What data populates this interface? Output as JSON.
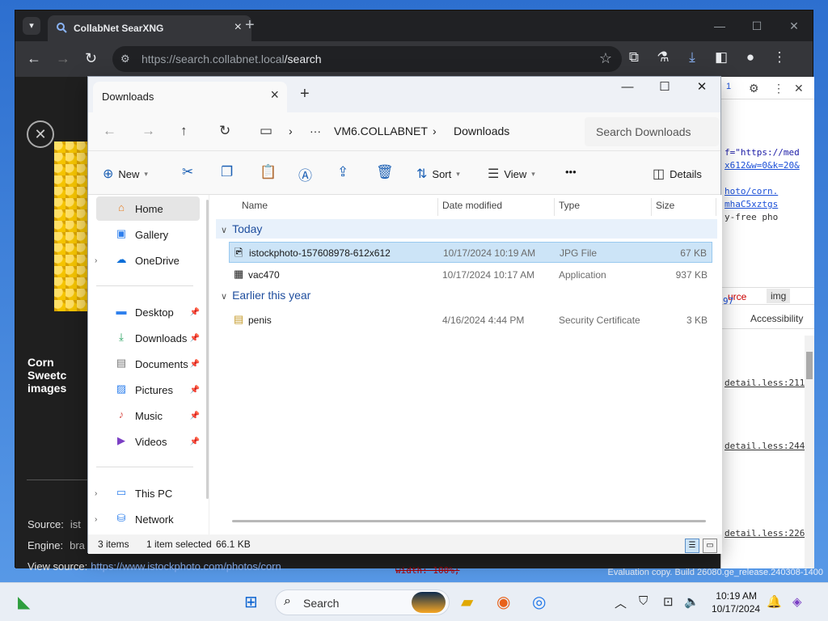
{
  "browser": {
    "tab_title": "CollabNet SearXNG",
    "url_host": "https://search.collabnet.local",
    "url_path": "/search",
    "page": {
      "image_title": "Corn Sweetc images",
      "meta": [
        {
          "label": "Source:",
          "value": "ist"
        },
        {
          "label": "Engine:",
          "value": "bra"
        },
        {
          "label": "View source:",
          "value": "https://www.istockphoto.com/photos/corn"
        }
      ]
    },
    "devtools": {
      "code_lines": [
        "f=\"https://med",
        "x612&w=0&k=20&",
        "",
        "hoto/corn.",
        "mhaC5xztgs",
        "y-free pho"
      ],
      "tab_source": "urce",
      "tab_img": "img",
      "side_a": "97",
      "side_b": "3K",
      "accessibility": "Accessibility",
      "less_links": [
        "detail.less:211",
        "detail.less:244",
        "detail.less:226"
      ],
      "struck_css": "width: 100%;"
    }
  },
  "explorer": {
    "tab_title": "Downloads",
    "breadcrumb": [
      "VM6.COLLABNET",
      "Downloads"
    ],
    "search_placeholder": "Search Downloads",
    "commands": {
      "new": "New",
      "sort": "Sort",
      "view": "View",
      "more": "•••",
      "details": "Details"
    },
    "nav": {
      "home": "Home",
      "gallery": "Gallery",
      "onedrive": "OneDrive",
      "desktop": "Desktop",
      "downloads": "Downloads",
      "documents": "Documents",
      "pictures": "Pictures",
      "music": "Music",
      "videos": "Videos",
      "this_pc": "This PC",
      "network": "Network"
    },
    "columns": {
      "name": "Name",
      "date": "Date modified",
      "type": "Type",
      "size": "Size"
    },
    "groups": [
      {
        "label": "Today",
        "files": [
          {
            "name": "istockphoto-157608978-612x612",
            "date": "10/17/2024 10:19 AM",
            "type": "JPG File",
            "size": "67 KB",
            "selected": true
          },
          {
            "name": "vac470",
            "date": "10/17/2024 10:17 AM",
            "type": "Application",
            "size": "937 KB",
            "selected": false
          }
        ]
      },
      {
        "label": "Earlier this year",
        "files": [
          {
            "name": "penis",
            "date": "4/16/2024 4:44 PM",
            "type": "Security Certificate",
            "size": "3 KB",
            "selected": false
          }
        ]
      }
    ],
    "status": {
      "items": "3 items",
      "selected": "1 item selected",
      "size": "66.1 KB"
    }
  },
  "desktop": {
    "evaluation": "Evaluation copy. Build 26080.ge_release.240308-1400"
  },
  "taskbar": {
    "search_label": "Search",
    "time": "10:19 AM",
    "date": "10/17/2024"
  }
}
